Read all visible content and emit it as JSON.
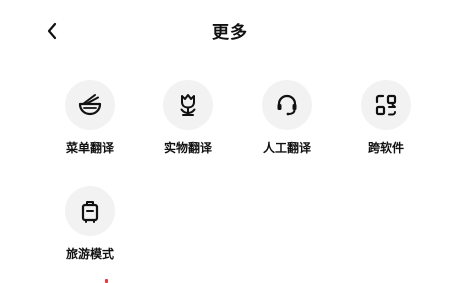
{
  "header": {
    "title": "更多",
    "back_icon": "chevron-left-icon"
  },
  "tiles": [
    {
      "label": "菜单翻译",
      "icon": "noodle-bowl-icon"
    },
    {
      "label": "实物翻译",
      "icon": "tulip-flower-icon"
    },
    {
      "label": "人工翻译",
      "icon": "headset-icon"
    },
    {
      "label": "跨软件",
      "icon": "app-switch-icon"
    },
    {
      "label": "旅游模式",
      "icon": "suitcase-icon"
    }
  ],
  "colors": {
    "background": "#ffffff",
    "icon_circle": "#f2f2f2",
    "text": "#111111",
    "accent_dot": "#e8383d"
  }
}
